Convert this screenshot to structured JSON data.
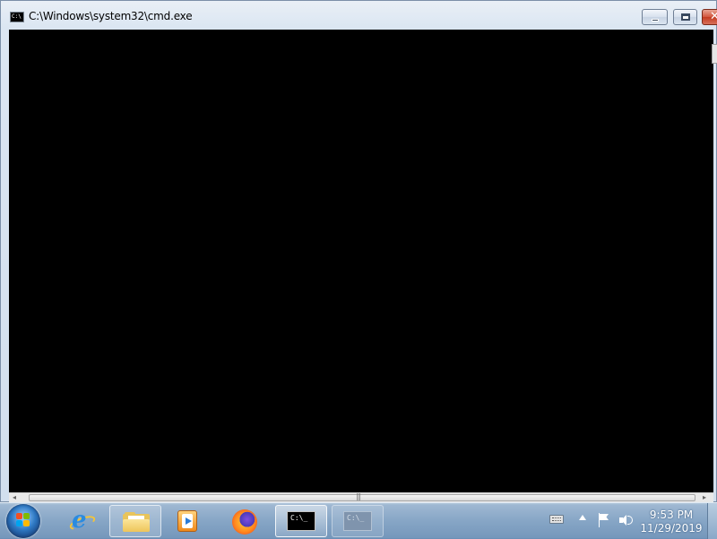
{
  "window": {
    "title": "C:\\Windows\\system32\\cmd.exe",
    "app_icon_text": "C:\\",
    "close_glyph": "✕",
    "console_text": ""
  },
  "scrollbar": {
    "left_arrow": "◂",
    "right_arrow": "▸",
    "grip": "|||"
  },
  "taskbar": {
    "items": [
      {
        "name": "start-button",
        "icon": "windows-logo-icon"
      },
      {
        "name": "internet-explorer",
        "icon": "internet-explorer-icon"
      },
      {
        "name": "windows-explorer",
        "icon": "folder-icon"
      },
      {
        "name": "windows-media-player",
        "icon": "media-player-icon"
      },
      {
        "name": "firefox",
        "icon": "firefox-icon"
      },
      {
        "name": "command-prompt",
        "icon": "cmd-icon",
        "label": "C:\\_"
      },
      {
        "name": "command-prompt-2",
        "icon": "cmd-icon",
        "label": "C:\\_"
      }
    ],
    "tray": {
      "icons": [
        "keyboard-icon",
        "show-hidden-icons-arrow",
        "action-center-flag-icon",
        "volume-icon"
      ],
      "time": "9:53 PM",
      "date": "11/29/2019"
    }
  },
  "colors": {
    "console_background": "#000000",
    "close_button": "#c83c22",
    "taskbar": "#87a6c6"
  }
}
